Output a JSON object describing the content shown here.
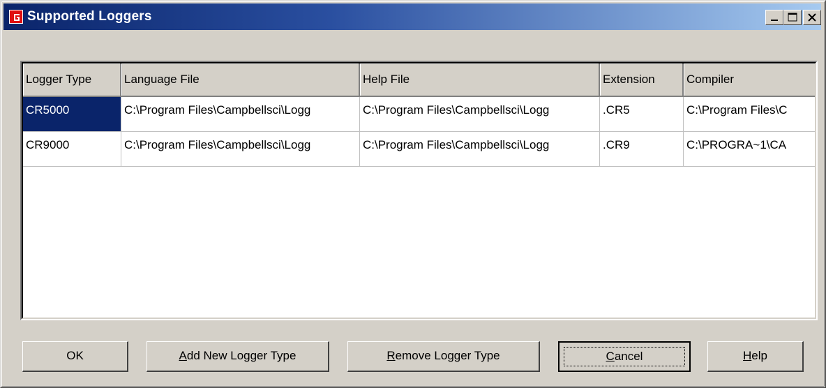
{
  "window": {
    "title": "Supported Loggers",
    "icon": "logger-app-icon"
  },
  "title_buttons": {
    "minimize": "minimize-icon",
    "maximize": "maximize-icon",
    "close": "close-icon"
  },
  "grid": {
    "columns": [
      "Logger Type",
      "Language File",
      "Help File",
      "Extension",
      "Compiler"
    ],
    "rows": [
      {
        "logger_type": "CR5000",
        "language_file": "C:\\Program Files\\Campbellsci\\Logg",
        "help_file": "C:\\Program Files\\Campbellsci\\Logg",
        "extension": ".CR5",
        "compiler": "C:\\Program Files\\C"
      },
      {
        "logger_type": "CR9000",
        "language_file": "C:\\Program Files\\Campbellsci\\Logg",
        "help_file": "C:\\Program Files\\Campbellsci\\Logg",
        "extension": ".CR9",
        "compiler": "C:\\PROGRA~1\\CA"
      }
    ],
    "selected_row": 0
  },
  "buttons": {
    "ok": "OK",
    "add_new_prefix": "A",
    "add_new_rest": "dd New Logger Type",
    "remove_prefix": "R",
    "remove_rest": "emove Logger Type",
    "cancel_prefix": "C",
    "cancel_rest": "ancel",
    "help_prefix": "H",
    "help_rest": "elp"
  },
  "colors": {
    "titlebar_start": "#0a246a",
    "titlebar_end": "#a6caf0",
    "selection": "#0a246a",
    "face": "#d4d0c8"
  }
}
